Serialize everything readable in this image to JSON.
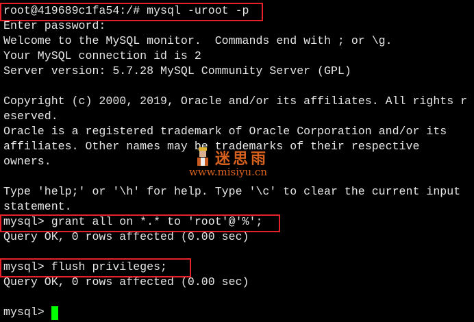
{
  "terminal": {
    "lines": [
      "root@419689c1fa54:/# mysql -uroot -p",
      "Enter password:",
      "Welcome to the MySQL monitor.  Commands end with ; or \\g.",
      "Your MySQL connection id is 2",
      "Server version: 5.7.28 MySQL Community Server (GPL)",
      "",
      "Copyright (c) 2000, 2019, Oracle and/or its affiliates. All rights reserved.",
      "",
      "Oracle is a registered trademark of Oracle Corporation and/or its",
      "affiliates. Other names may be trademarks of their respective",
      "owners.",
      "",
      "Type 'help;' or '\\h' for help. Type '\\c' to clear the current input statement.",
      "",
      "mysql> grant all on *.* to 'root'@'%';",
      "Query OK, 0 rows affected (0.00 sec)",
      "",
      "mysql> flush privileges;",
      "Query OK, 0 rows affected (0.00 sec)",
      "",
      "mysql> "
    ],
    "cursor_color": "#00ff00",
    "highlight_color": "#e8202a"
  },
  "watermark": {
    "chinese": "迷思雨",
    "url": "www.misiyu.cn"
  }
}
